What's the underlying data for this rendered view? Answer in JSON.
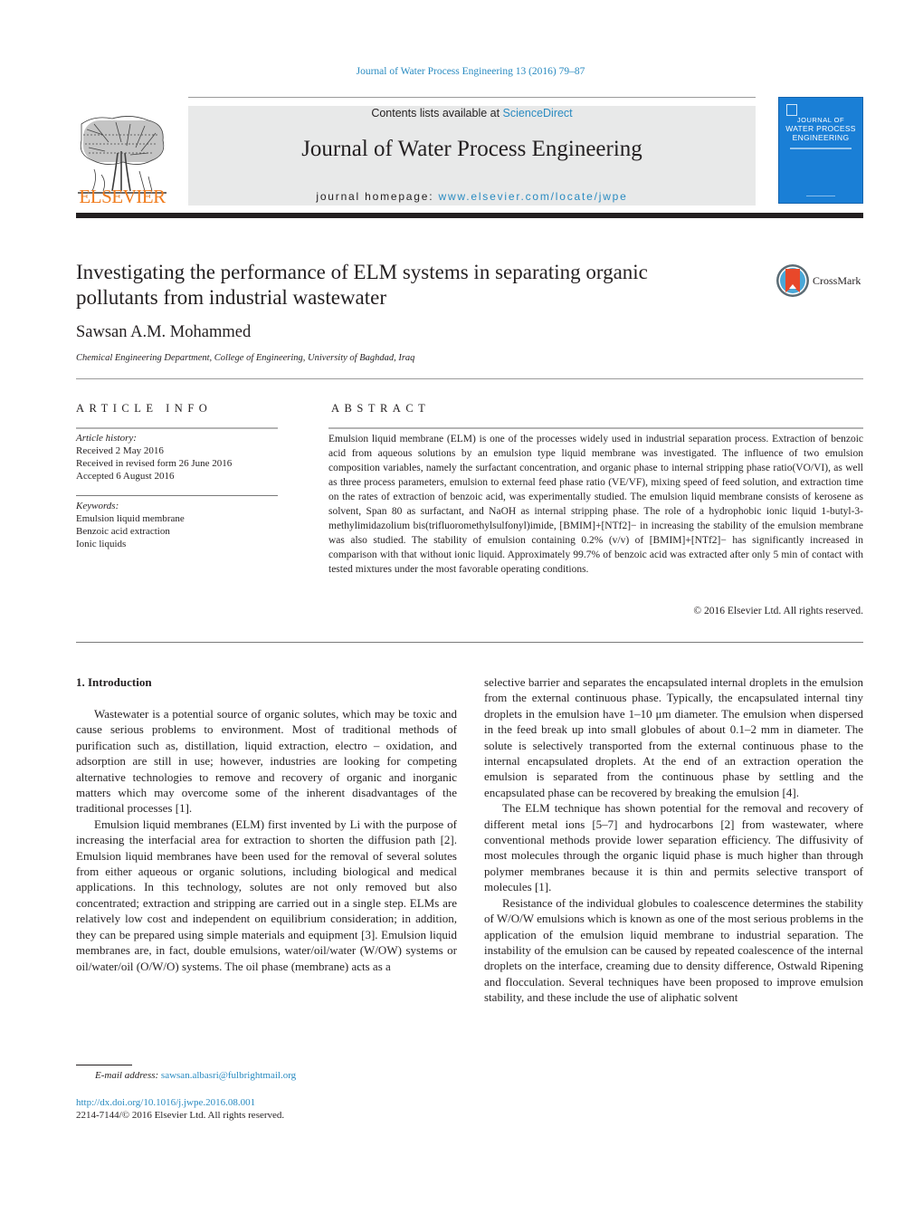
{
  "header": {
    "journal_ref": "Journal of Water Process Engineering 13 (2016) 79–87",
    "contents_prefix": "Contents lists available at ",
    "contents_link": "ScienceDirect",
    "journal_title": "Journal of Water Process Engineering",
    "homepage_prefix": "journal homepage: ",
    "homepage_link": "www.elsevier.com/locate/jwpe",
    "publisher_logo_text": "ELSEVIER",
    "cover": {
      "line1": "JOURNAL OF",
      "line2": "WATER PROCESS",
      "line3": "ENGINEERING",
      "color": "#1a7fd6"
    },
    "crossmark_label": "CrossMark"
  },
  "article": {
    "title_line1": "Investigating the performance of ELM systems in separating organic",
    "title_line2": "pollutants from industrial wastewater",
    "author": "Sawsan A.M. Mohammed",
    "affiliation": "Chemical Engineering Department, College of Engineering, University of Baghdad, Iraq"
  },
  "article_info": {
    "heading": "ARTICLE INFO",
    "history_label": "Article history:",
    "history": [
      "Received 2 May 2016",
      "Received in revised form 26 June 2016",
      "Accepted 6 August 2016"
    ],
    "keywords_label": "Keywords:",
    "keywords": [
      "Emulsion liquid membrane",
      "Benzoic acid extraction",
      "Ionic liquids"
    ]
  },
  "abstract": {
    "heading": "ABSTRACT",
    "text": "Emulsion liquid membrane (ELM) is one of the processes widely used in industrial separation process. Extraction of benzoic acid from aqueous solutions by an emulsion type liquid membrane was investigated. The influence of two emulsion composition variables, namely the surfactant concentration, and organic phase to internal stripping phase ratio(VO/VI), as well as three process parameters, emulsion to external feed phase ratio (VE/VF), mixing speed of feed solution, and extraction time on the rates of extraction of benzoic acid, was experimentally studied. The emulsion liquid membrane consists of kerosene as solvent, Span 80 as surfactant, and NaOH as internal stripping phase. The role of a hydrophobic ionic liquid 1-butyl-3-methylimidazolium bis(trifluoromethylsulfonyl)imide, [BMIM]+[NTf2]− in increasing the stability of the emulsion membrane was also studied. The stability of emulsion containing 0.2% (v/v) of [BMIM]+[NTf2]− has significantly increased in comparison with that without ionic liquid. Approximately 99.7% of benzoic acid was extracted after only 5 min of contact with tested mixtures under the most favorable operating conditions.",
    "copyright": "© 2016 Elsevier Ltd. All rights reserved."
  },
  "body": {
    "section_heading": "1.  Introduction",
    "left_paragraphs": [
      "Wastewater is a potential source of organic solutes, which may be toxic and cause serious problems to environment. Most of traditional methods of purification such as, distillation, liquid extraction, electro – oxidation, and adsorption are still in use; however, industries are looking for competing alternative technologies to remove and recovery of organic and inorganic matters which may overcome some of the inherent disadvantages of the traditional processes [1].",
      "Emulsion liquid membranes (ELM) first invented by Li with the purpose of increasing the interfacial area for extraction to shorten the diffusion path [2]. Emulsion liquid membranes have been used for the removal of several solutes from either aqueous or organic solutions, including biological and medical applications. In this technology, solutes are not only removed but also concentrated; extraction and stripping are carried out in a single step. ELMs are relatively low cost and independent on equilibrium consideration; in addition, they can be prepared using simple materials and equipment [3]. Emulsion liquid membranes are, in fact, double emulsions, water/oil/water (W/OW) systems or oil/water/oil (O/W/O) systems. The oil phase (membrane) acts as a"
    ],
    "right_paragraphs": [
      "selective barrier and separates the encapsulated internal droplets in the emulsion from the external continuous phase. Typically, the encapsulated internal tiny droplets in the emulsion have 1–10 μm diameter. The emulsion when dispersed in the feed break up into small globules of about 0.1–2 mm in diameter. The solute is selectively transported from the external continuous phase to the internal encapsulated droplets. At the end of an extraction operation the emulsion is separated from the continuous phase by settling and the encapsulated phase can be recovered by breaking the emulsion [4].",
      "The ELM technique has shown potential for the removal and recovery of different metal ions [5–7] and hydrocarbons [2] from wastewater, where conventional methods provide lower separation efficiency. The diffusivity of most molecules through the organic liquid phase is much higher than through polymer membranes because it is thin and permits selective transport of molecules [1].",
      "Resistance of the individual globules to coalescence determines the stability of W/O/W emulsions which is known as one of the most serious problems in the application of the emulsion liquid membrane to industrial separation. The instability of the emulsion can be caused by repeated coalescence of the internal droplets on the interface, creaming due to density difference, Ostwald Ripening and flocculation. Several techniques have been proposed to improve emulsion stability, and these include the use of aliphatic solvent"
    ]
  },
  "footer": {
    "email_label": "E-mail address: ",
    "email": "sawsan.albasri@fulbrightmail.org",
    "doi": "http://dx.doi.org/10.1016/j.jwpe.2016.08.001",
    "issn": "2214-7144/© 2016 Elsevier Ltd. All rights reserved."
  }
}
